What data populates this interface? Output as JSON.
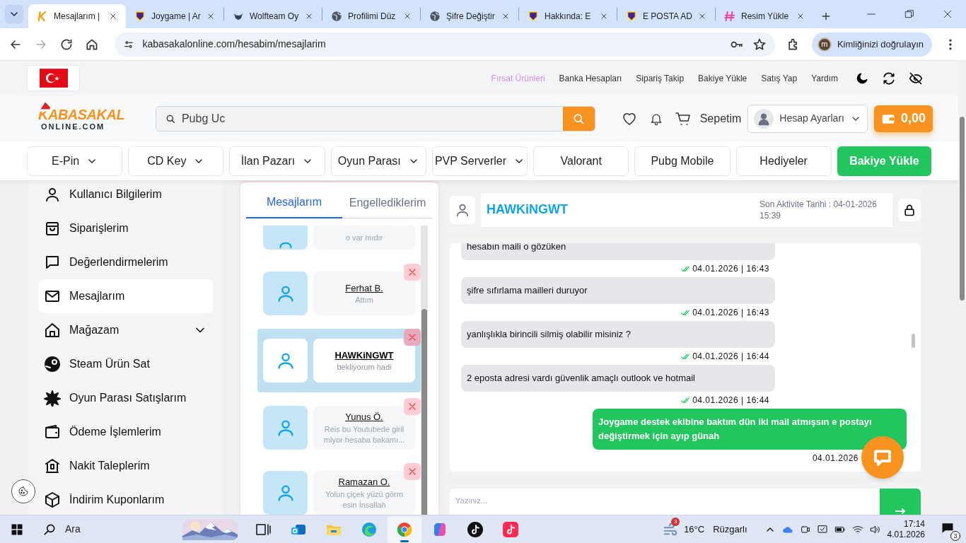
{
  "browser": {
    "tabs": [
      {
        "title": "Mesajlarım |",
        "selected": true,
        "kind": "k"
      },
      {
        "title": "Joygame | Ar",
        "selected": false,
        "kind": "shield"
      },
      {
        "title": "Wolfteam Oy",
        "selected": false,
        "kind": "wolf"
      },
      {
        "title": "Profilimi Düz",
        "selected": false,
        "kind": "globe"
      },
      {
        "title": "Şifre Değiştir",
        "selected": false,
        "kind": "globe"
      },
      {
        "title": "Hakkında: E",
        "selected": false,
        "kind": "shield"
      },
      {
        "title": "E POSTA AD",
        "selected": false,
        "kind": "shield"
      },
      {
        "title": "Resim Yükle",
        "selected": false,
        "kind": "h"
      }
    ],
    "url": "kabasakalonline.com/hesabim/mesajlarim",
    "profile": {
      "initial": "m",
      "label": "Kimliğinizi doğrulayın"
    }
  },
  "site": {
    "top_links": [
      {
        "label": "Fırsat Ürünleri",
        "highlight": true
      },
      {
        "label": "Banka Hesapları",
        "highlight": false
      },
      {
        "label": "Sipariş Takip",
        "highlight": false
      },
      {
        "label": "Bakiye Yükle",
        "highlight": false
      },
      {
        "label": "Satış Yap",
        "highlight": false
      },
      {
        "label": "Yardım",
        "highlight": false
      }
    ],
    "logo": {
      "line1": "KABASAKAL",
      "line2": "ONLINE.COM"
    },
    "search": {
      "value": "Pubg Uc"
    },
    "cart_label": "Sepetim",
    "account_label": "Hesap Ayarları",
    "balance": "0,00",
    "nav": [
      {
        "label": "E-Pin",
        "kind": "menu"
      },
      {
        "label": "CD Key",
        "kind": "menu"
      },
      {
        "label": "İlan Pazarı",
        "kind": "menu"
      },
      {
        "label": "Oyun Parası",
        "kind": "menu"
      },
      {
        "label": "PVP Serverler",
        "kind": "menu"
      },
      {
        "label": "Valorant",
        "kind": "link"
      },
      {
        "label": "Pubg Mobile",
        "kind": "link"
      },
      {
        "label": "Hediyeler",
        "kind": "link"
      },
      {
        "label": "Bakiye Yükle",
        "kind": "cta"
      }
    ]
  },
  "sidebar": {
    "items": [
      {
        "label": "Kullanıcı Bilgilerim",
        "selected": false,
        "expandable": false
      },
      {
        "label": "Siparişlerim",
        "selected": false,
        "expandable": false
      },
      {
        "label": "Değerlendirmelerim",
        "selected": false,
        "expandable": false
      },
      {
        "label": "Mesajlarım",
        "selected": true,
        "expandable": false
      },
      {
        "label": "Mağazam",
        "selected": false,
        "expandable": true
      },
      {
        "label": "Steam Ürün Sat",
        "selected": false,
        "expandable": false
      },
      {
        "label": "Oyun Parası Satışlarım",
        "selected": false,
        "expandable": false
      },
      {
        "label": "Ödeme İşlemlerim",
        "selected": false,
        "expandable": false
      },
      {
        "label": "Nakit Taleplerim",
        "selected": false,
        "expandable": false
      },
      {
        "label": "İndirim Kuponlarım",
        "selected": false,
        "expandable": false
      }
    ]
  },
  "conversations": {
    "tabs": [
      {
        "label": "Mesajlarım",
        "selected": true
      },
      {
        "label": "Engellediklerim",
        "selected": false
      }
    ],
    "items": [
      {
        "preview": "o var mıdır",
        "selected": false,
        "partial": true
      },
      {
        "name": "Ferhat B.",
        "preview": "Attım",
        "selected": false
      },
      {
        "name": "HAWKiNGWT",
        "preview": "bekliyorum hadi",
        "selected": true
      },
      {
        "name": "Yunus Ö.",
        "preview": "Reis bu Youtubede giril mlyor hesaba bakamı...",
        "selected": false
      },
      {
        "name": "Ramazan O.",
        "preview": "Yolun çiçek yüzü görm esin İnsallah",
        "selected": false
      }
    ]
  },
  "chat": {
    "user": "HAWKiNGWT",
    "last_activity": "Son Aktivite Tarihi : 04-01-2026 15:39",
    "messages": [
      {
        "text": "hesabın maili o gözüken",
        "time": "04.01.2026 | 16:43",
        "outgoing": false,
        "read": true
      },
      {
        "text": "şifre sıfırlama mailleri duruyor",
        "time": "04.01.2026 | 16:43",
        "outgoing": false,
        "read": true
      },
      {
        "text": "yanlışlıkla birincili silmiş olabilir misiniz ?",
        "time": "04.01.2026 | 16:44",
        "outgoing": false,
        "read": true
      },
      {
        "text": "2 eposta adresi vardı güvenlik amaçlı outlook ve hotmail",
        "time": "04.01.2026 | 16:44",
        "outgoing": false,
        "read": true
      },
      {
        "text": "Joygame destek ekibine baktım dün iki mail atmışsın e postayı değiştirmek için ayıp günah",
        "time": "04.01.2026",
        "outgoing": true,
        "read": false
      }
    ],
    "input_placeholder": "Yazınız..."
  },
  "taskbar": {
    "search_placeholder": "Ara",
    "apps": [
      {
        "selected": false
      },
      {
        "selected": false
      },
      {
        "selected": false
      },
      {
        "selected": false
      },
      {
        "selected": true
      },
      {
        "selected": false
      },
      {
        "selected": false
      },
      {
        "selected": false
      }
    ],
    "weather": {
      "temp": "16°C",
      "label": "Rüzgarlı",
      "badge": "3"
    },
    "time": "17:14",
    "date": "4.01.2026",
    "notifications": "3"
  }
}
